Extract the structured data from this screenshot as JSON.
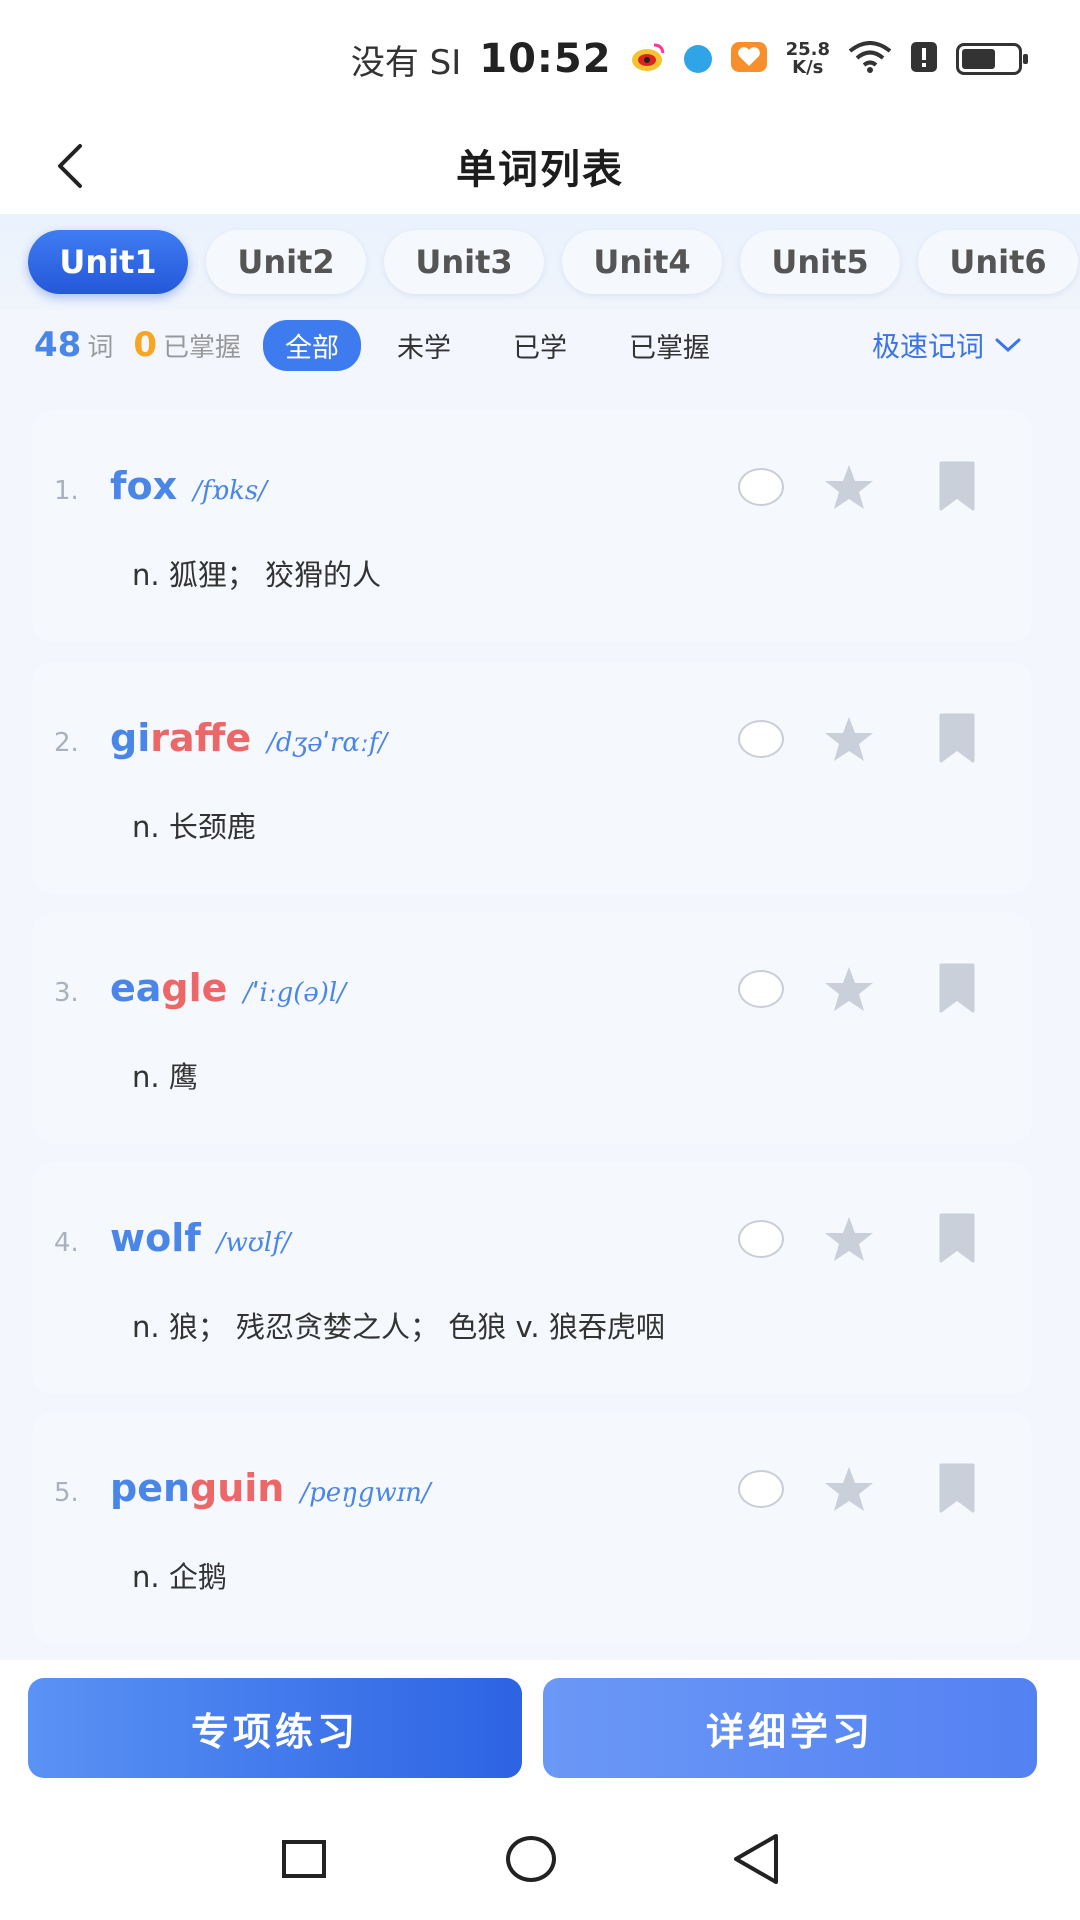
{
  "status_bar": {
    "carrier": "没有 SI",
    "time": "10:52",
    "net_speed_value": "25.8",
    "net_speed_unit": "K/s",
    "battery_level": 0.55,
    "icons": [
      "weibo-icon",
      "browser-icon",
      "health-app-icon",
      "wifi-icon",
      "alert-icon",
      "battery-icon"
    ]
  },
  "header": {
    "title": "单词列表",
    "back_icon": "chevron-left-icon"
  },
  "unit_tabs": [
    {
      "label": "Unit1",
      "active": true
    },
    {
      "label": "Unit2",
      "active": false
    },
    {
      "label": "Unit3",
      "active": false
    },
    {
      "label": "Unit4",
      "active": false
    },
    {
      "label": "Unit5",
      "active": false
    },
    {
      "label": "Unit6",
      "active": false
    }
  ],
  "filter": {
    "word_count": "48",
    "word_count_label": "词",
    "mastered_count": "0",
    "mastered_label": "已掌握",
    "chips": [
      {
        "label": "全部",
        "active": true
      },
      {
        "label": "未学",
        "active": false
      },
      {
        "label": "已学",
        "active": false
      },
      {
        "label": "已掌握",
        "active": false
      }
    ],
    "speed_mode_label": "极速记词"
  },
  "words": [
    {
      "index": "1.",
      "parts": [
        {
          "t": "fox",
          "hl": false
        }
      ],
      "phonetic": "/fɒks/",
      "meaning": "n. 狐狸； 狡猾的人"
    },
    {
      "index": "2.",
      "parts": [
        {
          "t": "gi",
          "hl": false
        },
        {
          "t": "raffe",
          "hl": true
        }
      ],
      "phonetic": "/dʒəˈrɑːf/",
      "meaning": "n. 长颈鹿"
    },
    {
      "index": "3.",
      "parts": [
        {
          "t": "ea",
          "hl": false
        },
        {
          "t": "gle",
          "hl": true
        }
      ],
      "phonetic": "/ˈiːg(ə)l/",
      "meaning": "n. 鹰"
    },
    {
      "index": "4.",
      "parts": [
        {
          "t": "wolf",
          "hl": false
        }
      ],
      "phonetic": "/wʊlf/",
      "meaning": "n. 狼； 残忍贪婪之人； 色狼 v. 狼吞虎咽"
    },
    {
      "index": "5.",
      "parts": [
        {
          "t": "pen",
          "hl": false
        },
        {
          "t": "guin",
          "hl": true
        }
      ],
      "phonetic": "/peŋgwɪn/",
      "meaning": "n. 企鹅"
    }
  ],
  "bottom_buttons": {
    "practice": "专项练习",
    "study": "详细学习"
  },
  "colors": {
    "accent": "#3d7bef",
    "word_blue": "#4a86e8",
    "highlight_red": "#ec6868",
    "mastered_orange": "#f6a623",
    "icon_gray": "#c9d0da"
  }
}
